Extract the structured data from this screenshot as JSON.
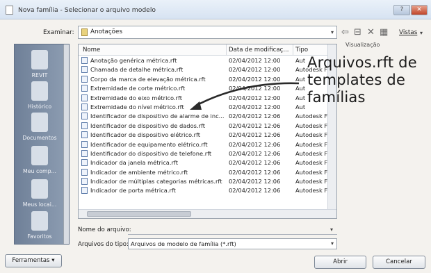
{
  "window": {
    "title": "Nova família - Selecionar o arquivo modelo",
    "help_symbol": "?",
    "close_symbol": "✕"
  },
  "toolbar": {
    "look_in_label": "Examinar:",
    "look_in_value": "Anotações",
    "views_label": "Vistas",
    "preview_label": "Visualização"
  },
  "places": [
    "REVIT",
    "Histórico",
    "Documentos",
    "Meu comp...",
    "Meus locai...",
    "Favoritos"
  ],
  "columns": {
    "name": "Nome",
    "date": "Data de modificaç...",
    "type": "Tipo"
  },
  "files": [
    {
      "name": "Anotação genérica métrica.rft",
      "date": "02/04/2012 12:00",
      "type": "Aut"
    },
    {
      "name": "Chamada de detalhe métrica.rft",
      "date": "02/04/2012 12:00",
      "type": "Autodesk F"
    },
    {
      "name": "Corpo da marca de elevação métrica.rft",
      "date": "02/04/2012 12:00",
      "type": "Aut"
    },
    {
      "name": "Extremidade de corte métrico.rft",
      "date": "02/04/2012 12:00",
      "type": "Aut"
    },
    {
      "name": "Extremidade do eixo métrico.rft",
      "date": "02/04/2012 12:00",
      "type": "Aut"
    },
    {
      "name": "Extremidade do nível métrico.rft",
      "date": "02/04/2012 12:00",
      "type": "Aut"
    },
    {
      "name": "Identificador de dispositivo de alarme de inc...",
      "date": "02/04/2012 12:06",
      "type": "Autodesk F"
    },
    {
      "name": "Identificador de dispositivo de dados.rft",
      "date": "02/04/2012 12:06",
      "type": "Autodesk F"
    },
    {
      "name": "Identificador de dispositivo elétrico.rft",
      "date": "02/04/2012 12:06",
      "type": "Autodesk F"
    },
    {
      "name": "Identificador de equipamento elétrico.rft",
      "date": "02/04/2012 12:06",
      "type": "Autodesk F"
    },
    {
      "name": "Identificador do dispositivo de telefone.rft",
      "date": "02/04/2012 12:06",
      "type": "Autodesk F"
    },
    {
      "name": "Indicador da janela métrica.rft",
      "date": "02/04/2012 12:06",
      "type": "Autodesk F"
    },
    {
      "name": "Indicador de ambiente métrico.rft",
      "date": "02/04/2012 12:06",
      "type": "Autodesk F"
    },
    {
      "name": "Indicador de múltiplas categorias métricas.rft",
      "date": "02/04/2012 12:06",
      "type": "Autodesk F"
    },
    {
      "name": "Indicador de porta métrica.rft",
      "date": "02/04/2012 12:06",
      "type": "Autodesk F"
    }
  ],
  "file_name": {
    "label": "Nome do arquivo:",
    "value": ""
  },
  "file_type": {
    "label": "Arquivos do tipo:",
    "value": "Arquivos de modelo de família  (*.rft)"
  },
  "buttons": {
    "tools": "Ferramentas",
    "open": "Abrir",
    "cancel": "Cancelar"
  },
  "annotation": {
    "lines": [
      "Arquivos.rft de",
      "templates de",
      "famílias"
    ]
  }
}
